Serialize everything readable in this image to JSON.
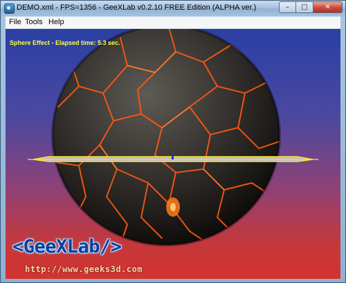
{
  "window": {
    "title": "DEMO.xml - FPS=1356 - GeeXLab v0.2.10 FREE Edition (ALPHA ver.)",
    "controls": {
      "minimize": "–",
      "maximize": "□",
      "close": "✕"
    }
  },
  "menu": {
    "file": "File",
    "tools": "Tools",
    "help": "Help"
  },
  "viewport": {
    "overlay_text": "Sphere Effect - Elapsed time: 5.3 sec.",
    "logo_text": "<GeeXLab/>",
    "url_text": "http://www.geeks3d.com"
  },
  "colors": {
    "overlay_text": "#ffff3a",
    "background_top": "#2b3fa4",
    "background_bottom": "#d4332e",
    "lava": "#ff5a10"
  }
}
